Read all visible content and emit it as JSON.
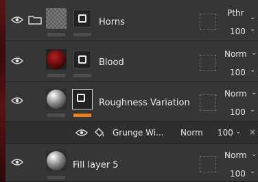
{
  "layers": [
    {
      "name": "Horns",
      "blend": "Pthr",
      "opacity": "100",
      "chevron": "⌄"
    },
    {
      "name": "Blood",
      "blend": "Norm",
      "opacity": "100",
      "chevron": "⌄"
    },
    {
      "name": "Roughness Variation",
      "blend": "Norm",
      "opacity": "100",
      "chevron": "⌄"
    },
    {
      "name": "Fill layer 5",
      "blend": "Norm",
      "opacity": "100",
      "chevron": "⌄"
    }
  ],
  "effect": {
    "name": "Grunge Wi...",
    "blend": "Norm",
    "opacity": "100",
    "chevron": "⌄",
    "close": "×"
  },
  "colors": {
    "accent": "#e8801f",
    "panel": "#363636"
  },
  "icons": [
    "eye-icon",
    "folder-icon",
    "fill-bucket-icon",
    "mask-icon",
    "close-icon"
  ]
}
